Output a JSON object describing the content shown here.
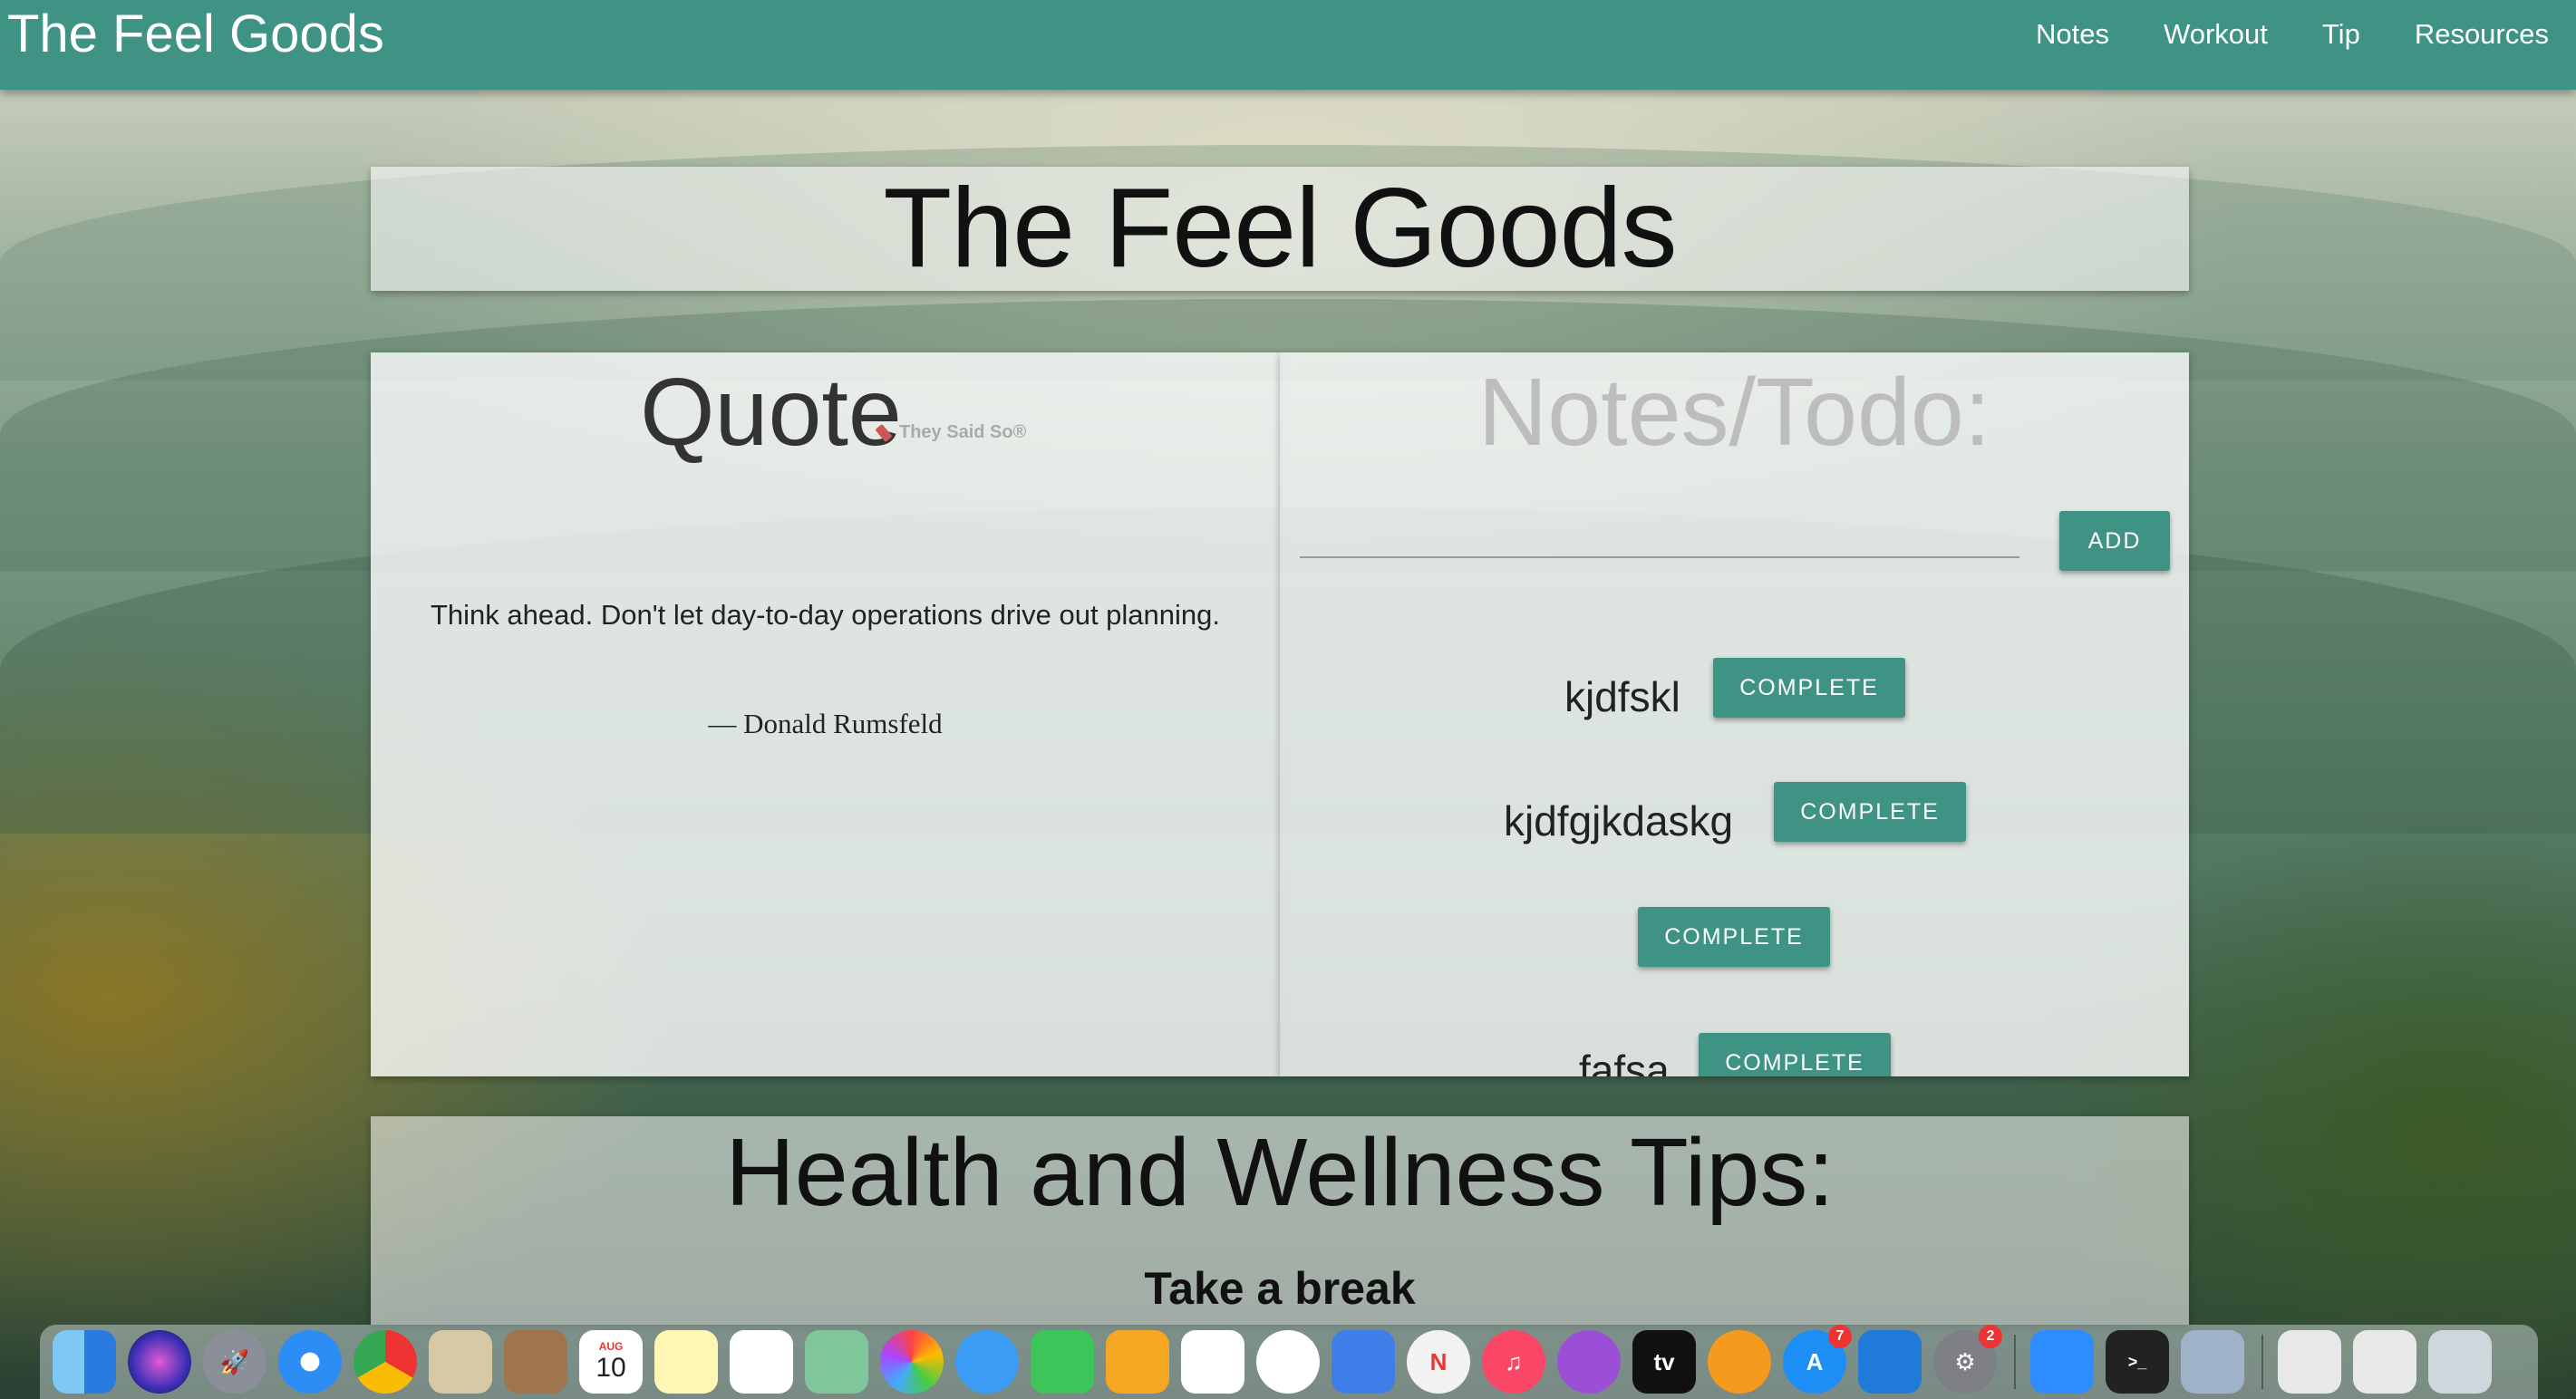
{
  "navbar": {
    "brand": "The Feel Goods",
    "links": [
      "Notes",
      "Workout",
      "Tip",
      "Resources"
    ]
  },
  "header": {
    "title": "The Feel Goods"
  },
  "quote": {
    "heading": "Quote",
    "attribution": "They Said So®",
    "text": "Think ahead. Don't let day-to-day operations drive out planning.",
    "author": "— Donald Rumsfeld"
  },
  "notes": {
    "heading": "Notes/Todo:",
    "input_value": "",
    "add_label": "ADD",
    "complete_label": "COMPLETE",
    "items": [
      "kjdfskl",
      "kjdfgjkdaskg",
      "",
      "fafsa"
    ]
  },
  "tips": {
    "heading": "Health and Wellness Tips:",
    "subheading": "Take a break"
  },
  "dock": {
    "calendar_month": "AUG",
    "calendar_day": "10",
    "appstore_badge": "7",
    "settings_badge": "2",
    "appletv_label": "tv"
  },
  "colors": {
    "accent": "#3e9384",
    "badge": "#e33333"
  }
}
